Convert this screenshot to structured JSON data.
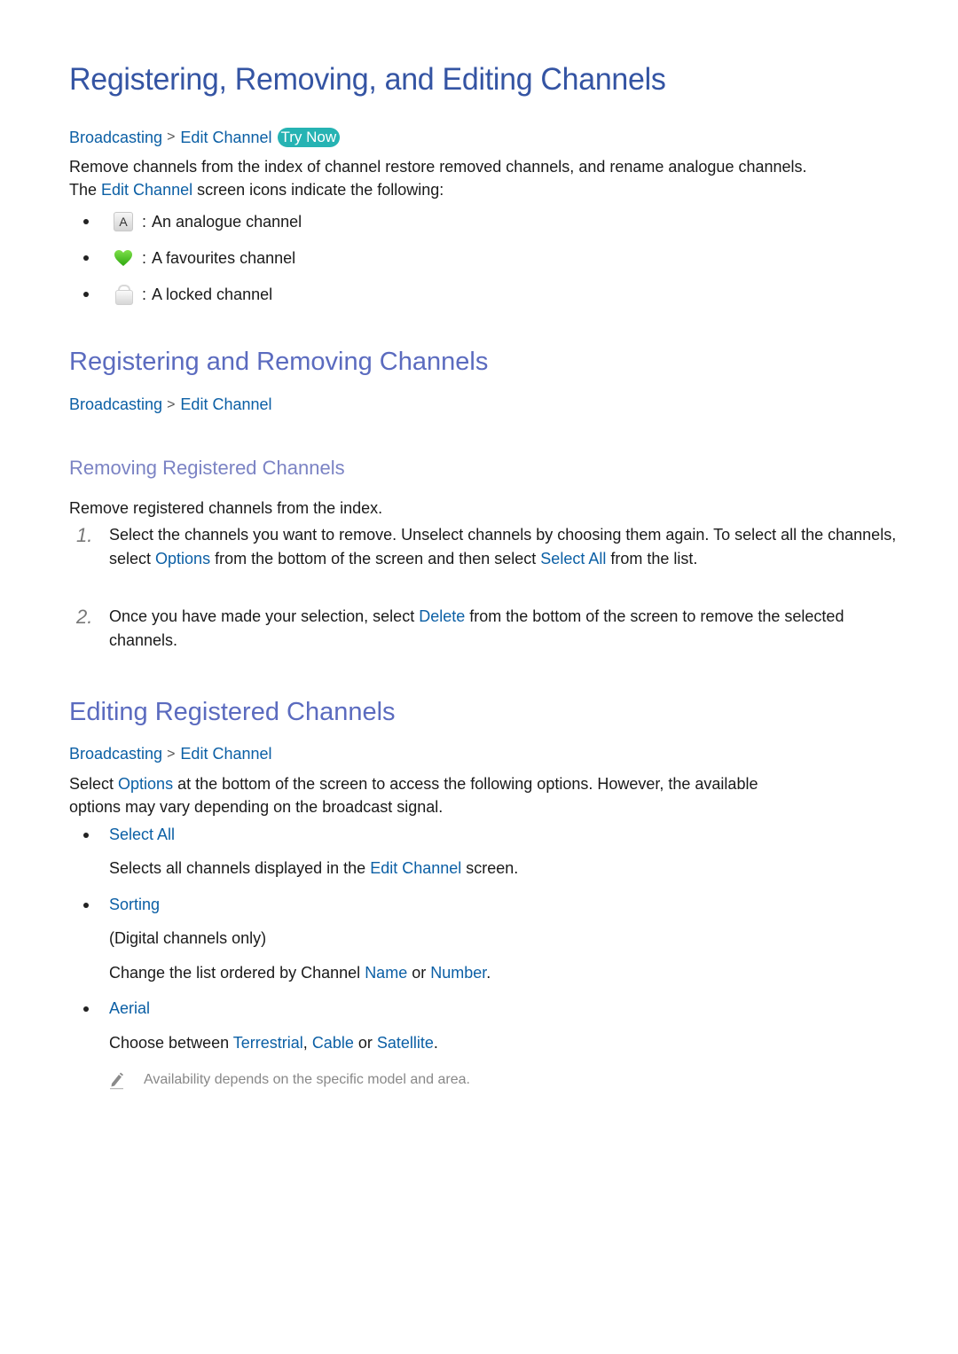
{
  "title": "Registering, Removing, and Editing Channels",
  "colors": {
    "title": "#3454a3",
    "heading": "#5b6bbf",
    "subheading": "#7b83c4",
    "link": "#0b5fa5",
    "try_now_bg": "#26b3b3",
    "favourite_icon": "#4cc724"
  },
  "intro": {
    "breadcrumb": {
      "item1": "Broadcasting",
      "separator": ">",
      "item2": "Edit Channel",
      "try_now": "Try Now"
    },
    "para_line1": "Remove channels from the index of channel restore removed channels, and rename analogue channels.",
    "para_line2_pre": "The ",
    "para_line2_link": "Edit Channel",
    "para_line2_post": " screen icons indicate the following:",
    "icons": [
      {
        "icon": "analogue-icon",
        "glyph": "A",
        "sep": ":",
        "label": "An analogue channel"
      },
      {
        "icon": "heart-icon",
        "sep": ":",
        "label": "A favourites channel"
      },
      {
        "icon": "lock-icon",
        "sep": ":",
        "label": "A locked channel"
      }
    ]
  },
  "section1": {
    "heading": "Registering and Removing Channels",
    "breadcrumb": {
      "item1": "Broadcasting",
      "separator": ">",
      "item2": "Edit Channel"
    },
    "sub": {
      "heading": "Removing Registered Channels",
      "intro": "Remove registered channels from the index.",
      "steps": [
        {
          "num": "1.",
          "t1": "Select the channels you want to remove. Unselect channels by choosing them again. To select all the channels, select ",
          "l1": "Options",
          "t2": " from the bottom of the screen and then select ",
          "l2": "Select All",
          "t3": " from the list."
        },
        {
          "num": "2.",
          "t1": "Once you have made your selection, select ",
          "l1": "Delete",
          "t2": " from the bottom of the screen to remove the selected channels."
        }
      ]
    }
  },
  "section2": {
    "heading": "Editing Registered Channels",
    "breadcrumb": {
      "item1": "Broadcasting",
      "separator": ">",
      "item2": "Edit Channel"
    },
    "para_pre": "Select ",
    "para_link": "Options",
    "para_post_line1": " at the bottom of the screen to access the following options. However, the available",
    "para_line2": "options may vary depending on the broadcast signal.",
    "options": [
      {
        "label": "Select All",
        "desc_pre": "Selects all channels displayed in the ",
        "desc_link": "Edit Channel",
        "desc_post": " screen."
      },
      {
        "label": "Sorting",
        "desc1": "(Digital channels only)",
        "desc2_pre": "Change the list ordered by Channel ",
        "desc2_link1": "Name",
        "desc2_mid": " or ",
        "desc2_link2": "Number",
        "desc2_post": "."
      },
      {
        "label": "Aerial",
        "desc_pre": "Choose between ",
        "desc_link1": "Terrestrial",
        "desc_sep1": ", ",
        "desc_link2": "Cable",
        "desc_sep2": " or ",
        "desc_link3": "Satellite",
        "desc_post": "."
      }
    ],
    "note": {
      "icon": "pencil-icon",
      "text": "Availability depends on the specific model and area."
    }
  }
}
